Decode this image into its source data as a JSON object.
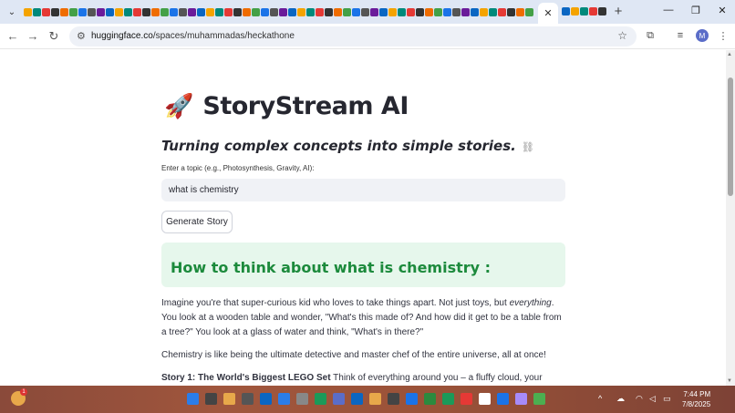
{
  "browser": {
    "active_tab_close": "✕",
    "new_tab": "+",
    "url_host": "huggingface.co",
    "url_path": "/spaces/muhammadas/heckathone",
    "profile_initial": "M",
    "colors": {
      "tabstrip": "#dfe7f4",
      "omnibox": "#eef1f7"
    }
  },
  "app": {
    "title": "StoryStream AI",
    "subtitle": "Turning complex concepts into simple stories.",
    "input_label": "Enter a topic (e.g., Photosynthesis, Gravity, AI):",
    "input_value": "what is chemistry",
    "button_label": "Generate Story",
    "result_heading": "How to think about what is chemistry :",
    "colors": {
      "result_bg": "#e6f7ec",
      "result_text": "#1c8a3c"
    },
    "story": {
      "p1_a": "Imagine you're that super-curious kid who loves to take things apart. Not just toys, but ",
      "p1_em": "everything",
      "p1_b": ". You look at a wooden table and wonder, \"What's this made of? And how did it get to be a table from a tree?\" You look at a glass of water and think, \"What's in there?\"",
      "p2": "Chemistry is like being the ultimate detective and master chef of the entire universe, all at once!",
      "p3_bold": "Story 1: The World's Biggest LEGO Set",
      "p3_rest": " Think of everything around you – a fluffy cloud, your morning"
    }
  },
  "taskbar": {
    "notification_count": "1",
    "time": "7:44 PM",
    "date": "7/8/2025"
  }
}
